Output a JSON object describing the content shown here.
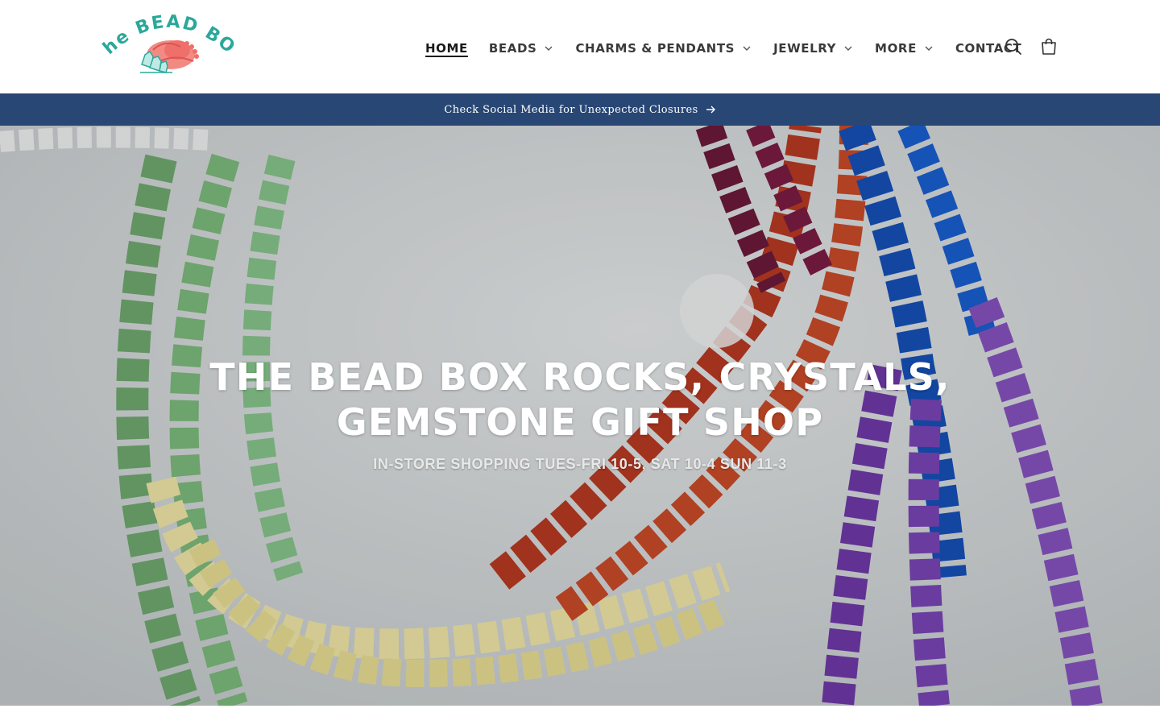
{
  "header": {
    "logo": {
      "text": "The BEAD BOX",
      "colors": {
        "text": "#2aa89a",
        "accent": "#ef6f6a"
      }
    },
    "nav": [
      {
        "label": "HOME",
        "active": true,
        "dropdown": false
      },
      {
        "label": "BEADS",
        "active": false,
        "dropdown": true
      },
      {
        "label": "CHARMS & PENDANTS",
        "active": false,
        "dropdown": true
      },
      {
        "label": "JEWELRY",
        "active": false,
        "dropdown": true
      },
      {
        "label": "MORE",
        "active": false,
        "dropdown": true
      },
      {
        "label": "CONTACT",
        "active": false,
        "dropdown": false
      }
    ],
    "icons": {
      "search": "search-icon",
      "cart": "cart-icon"
    }
  },
  "announcement": {
    "text": "Check Social Media for Unexpected Closures",
    "icon": "arrow-right-icon",
    "background": "#284774"
  },
  "hero": {
    "title_line1": "THE BEAD BOX ROCKS, CRYSTALS,",
    "title_line2": "GEMSTONE GIFT SHOP",
    "subtitle": "IN-STORE SHOPPING TUES-FRI 10-5, SAT 10-4 SUN 11-3"
  }
}
